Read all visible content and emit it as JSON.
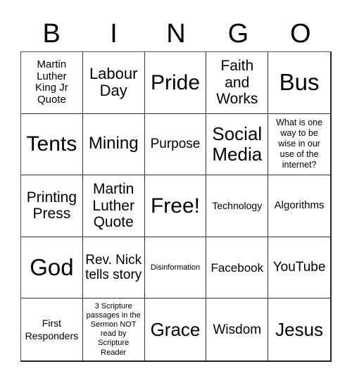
{
  "header": {
    "letters": [
      "B",
      "I",
      "N",
      "G",
      "O"
    ]
  },
  "cells": [
    "Martin Luther King Jr Quote",
    "Labour Day",
    "Pride",
    "Faith and Works",
    "Bus",
    "Tents",
    "Mining",
    "Purpose",
    "Social Media",
    "What is one way to be wise in our use of the internet?",
    "Printing Press",
    "Martin Luther Quote",
    "Free!",
    "Technology",
    "Algorithms",
    "God",
    "Rev. Nick tells story",
    "Disinformation",
    "Facebook",
    "YouTube",
    "First Responders",
    "3 Scripture passages in the Sermon NOT read by Scripture Reader",
    "Grace",
    "Wisdom",
    "Jesus"
  ]
}
